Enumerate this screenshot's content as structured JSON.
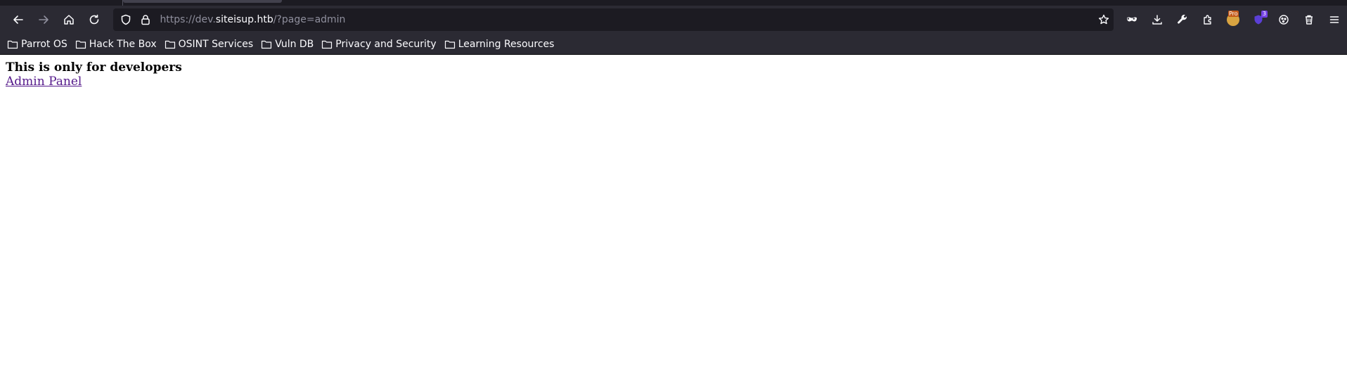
{
  "browser": {
    "url": {
      "prefix": "https://dev.",
      "host": "siteisup.htb",
      "path": "/?page=admin"
    },
    "nav": {
      "back_icon": "arrow-left-icon",
      "forward_icon": "arrow-right-icon",
      "home_icon": "home-icon",
      "reload_icon": "reload-icon"
    },
    "toolbar": {
      "extension_badge": "3",
      "pro_label": "Pro"
    },
    "bookmarks": [
      {
        "label": "Parrot OS"
      },
      {
        "label": "Hack The Box"
      },
      {
        "label": "OSINT Services"
      },
      {
        "label": "Vuln DB"
      },
      {
        "label": "Privacy and Security"
      },
      {
        "label": "Learning Resources"
      }
    ]
  },
  "page": {
    "heading": "This is only for developers",
    "link": "Admin Panel"
  },
  "colors": {
    "chrome_bg": "#2b2a33",
    "url_bg": "#1c1b22",
    "link_visited": "#551a8b"
  }
}
